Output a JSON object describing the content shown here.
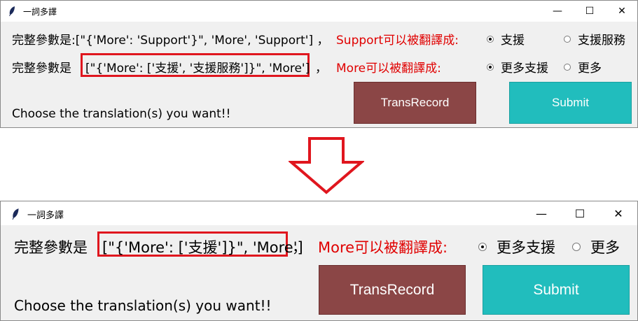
{
  "before": {
    "window": {
      "title": "一詞多譯",
      "min": "—",
      "max": "☐",
      "close": "✕"
    },
    "row1": {
      "params_text": "完整參數是:[\"{'More': 'Support'}\", 'More', 'Support'] ，",
      "translate_label": "Support可以被翻譯成:",
      "options": [
        {
          "label": "支援",
          "selected": true
        },
        {
          "label": "支援服務",
          "selected": false
        }
      ]
    },
    "row2": {
      "prefix": "完整參數是",
      "highlighted": "[\"{'More': ['支援', '支援服務']}\", 'More']",
      "suffix": "，",
      "translate_label": "More可以被翻譯成:",
      "options": [
        {
          "label": "更多支援",
          "selected": true
        },
        {
          "label": "更多",
          "selected": false
        }
      ]
    },
    "instruction": "Choose the translation(s) you want!!",
    "buttons": {
      "transrecord": "TransRecord",
      "submit": "Submit"
    }
  },
  "after": {
    "window": {
      "title": "一詞多譯",
      "min": "—",
      "max": "☐",
      "close": "✕"
    },
    "row1": {
      "prefix": "完整參數是",
      "highlighted": "[\"{'More': ['支援']}\", 'More']",
      "suffix": "，",
      "translate_label": "More可以被翻譯成:",
      "options": [
        {
          "label": "更多支援",
          "selected": true
        },
        {
          "label": "更多",
          "selected": false
        }
      ]
    },
    "instruction": "Choose the translation(s) you want!!",
    "buttons": {
      "transrecord": "TransRecord",
      "submit": "Submit"
    }
  },
  "colors": {
    "accent_red": "#e00000",
    "highlight_border": "#e0161e",
    "button_brown": "#8b4646",
    "button_teal": "#21bdbd",
    "window_bg": "#f0f0f0"
  },
  "icons": [
    "feather-icon",
    "minimize-icon",
    "maximize-icon",
    "close-icon",
    "down-arrow-icon",
    "radio-icon"
  ]
}
